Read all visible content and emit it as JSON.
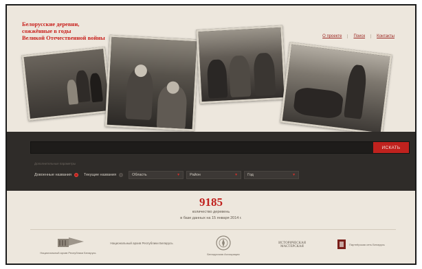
{
  "header": {
    "title_lines": [
      "Белорусские деревни,",
      "сожжённые в годы",
      "Великой Отечественной войны"
    ],
    "nav": [
      {
        "label": "О проекте"
      },
      {
        "label": "Поиск"
      },
      {
        "label": "Контакты"
      }
    ]
  },
  "search": {
    "input_value": "",
    "input_placeholder": "",
    "button_label": "ИСКАТЬ",
    "filter_caption": "Дополнительные параметры",
    "radios": [
      {
        "label": "Довоенные названия",
        "selected": true
      },
      {
        "label": "Текущие названия",
        "selected": false
      }
    ],
    "selects": [
      {
        "value": "Область"
      },
      {
        "value": "Район"
      },
      {
        "value": "Год"
      }
    ]
  },
  "stats": {
    "count": "9185",
    "caption_line1": "количество деревень",
    "caption_line2": "в базе данных на 15 января 2014 г."
  },
  "partners": [
    {
      "caption": "Национальный архив Республики Беларусь"
    },
    {
      "caption": "Национальный архив Республики Беларусь"
    },
    {
      "caption": "Беларусская Ассоциация"
    },
    {
      "caption": "ИСТОРИЧЕСКАЯ МАСТЕРСКАЯ"
    },
    {
      "caption": "Партнёрская сеть Беларусь"
    }
  ],
  "colors": {
    "accent": "#c0221e",
    "page_bg": "#ede7dd",
    "band_bg": "#2f2c29"
  }
}
